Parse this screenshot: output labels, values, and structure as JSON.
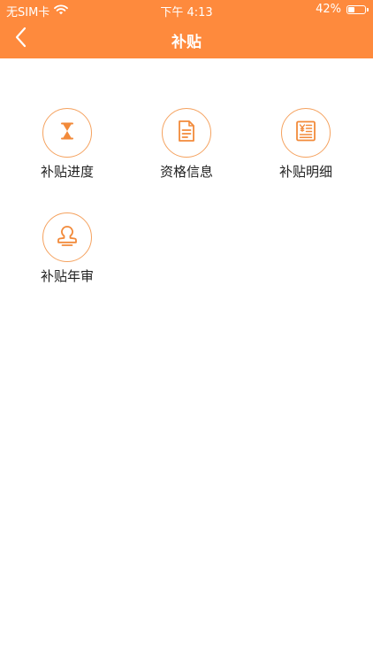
{
  "status_bar": {
    "carrier": "无SIM卡",
    "time": "下午 4:13",
    "battery_percent": "42%",
    "battery_level": 0.42
  },
  "nav": {
    "title": "补贴",
    "back_icon": "chevron-left-icon"
  },
  "colors": {
    "accent": "#fe8a3d",
    "icon_stroke": "#f28a3a",
    "circle_border": "#f5a25f",
    "label_text": "#222222"
  },
  "menu": {
    "items": [
      {
        "label": "补贴进度",
        "icon": "hourglass-icon"
      },
      {
        "label": "资格信息",
        "icon": "document-icon"
      },
      {
        "label": "补贴明细",
        "icon": "receipt-yuan-icon"
      },
      {
        "label": "补贴年审",
        "icon": "stamp-icon"
      }
    ]
  }
}
